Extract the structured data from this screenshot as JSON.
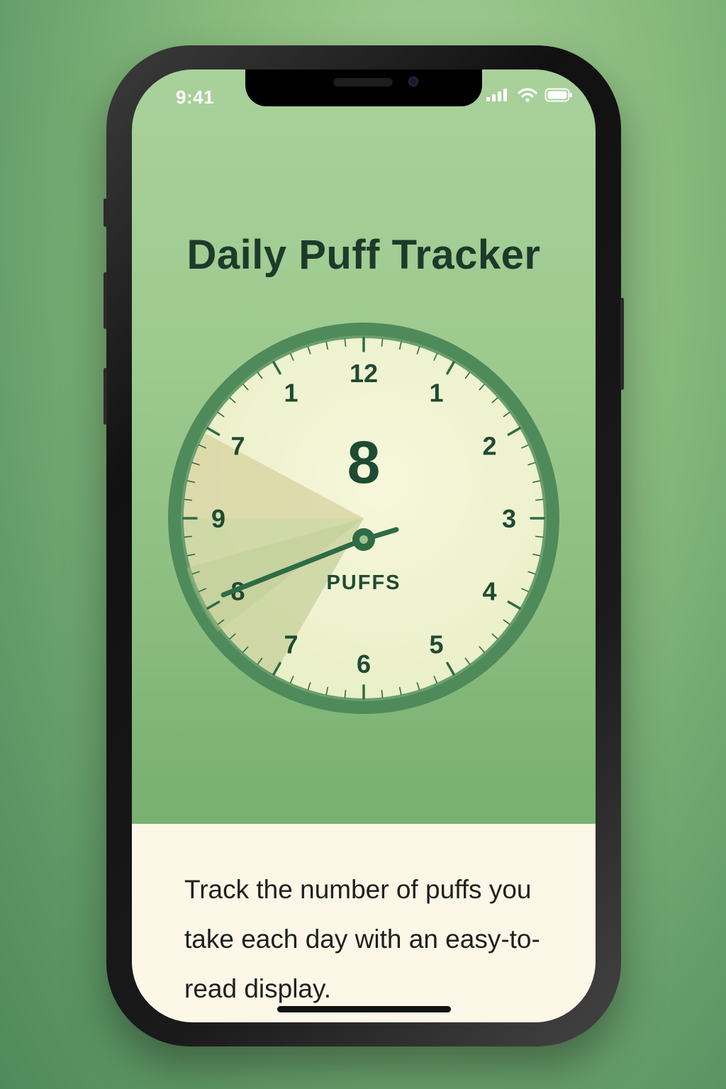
{
  "status_bar": {
    "time": "9:41",
    "icons": [
      "cellular-signal-icon",
      "wifi-icon",
      "battery-icon"
    ]
  },
  "app": {
    "title": "Daily Puff Tracker"
  },
  "dial": {
    "puff_count": "8",
    "unit_label": "PUFFS",
    "numerals": [
      "12",
      "1",
      "2",
      "3",
      "4",
      "5",
      "6",
      "7",
      "8",
      "9",
      "7",
      "1"
    ],
    "colors": {
      "ring": "#4f8a5a",
      "face": "#f2f3d2",
      "text": "#1f4a33",
      "hand": "#2e6b46",
      "highlight": "#d9d9a8"
    }
  },
  "description": {
    "text": "Track the number of puffs you take each day with an easy-to-read display."
  },
  "colors": {
    "background": "#86b97c",
    "panel": "#fcf7e6",
    "title": "#1d3a2a"
  }
}
